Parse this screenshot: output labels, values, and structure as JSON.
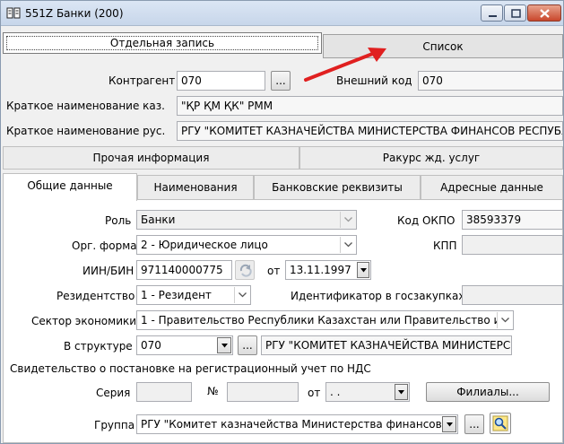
{
  "window": {
    "title": "551Z Банки (200)"
  },
  "top_tabs": {
    "record": "Отдельная запись",
    "list": "Список"
  },
  "header": {
    "counterparty_label": "Контрагент",
    "counterparty_value": "070",
    "external_code_label": "Внешний код",
    "external_code_value": "070",
    "short_name_kaz_label": "Краткое наименование каз.",
    "short_name_kaz_value": "\"ҚР ҚМ ҚК\" РММ",
    "short_name_rus_label": "Краткое наименование рус.",
    "short_name_rus_value": "РГУ \"КОМИТЕТ КАЗНАЧЕЙСТВА МИНИСТЕРСТВА ФИНАНСОВ РЕСПУБЛ",
    "ellipsis": "..."
  },
  "section_tabs": [
    "Прочая информация",
    "Ракурс жд. услуг"
  ],
  "sub_tabs": [
    "Общие данные",
    "Наименования",
    "Банковские реквизиты",
    "Адресные данные"
  ],
  "form": {
    "role_label": "Роль",
    "role_value": "Банки",
    "okpo_label": "Код ОКПО",
    "okpo_value": "38593379",
    "org_form_label": "Орг. форма",
    "org_form_value": "2 - Юридическое лицо",
    "kpp_label": "КПП",
    "kpp_value": "",
    "iin_label": "ИИН/БИН",
    "iin_value": "971140000775",
    "from_label": "от",
    "date_value": "13.11.1997",
    "residency_label": "Резидентство",
    "residency_value": "1 - Резидент",
    "procurement_id_label": "Идентификатор в госзакупках",
    "procurement_id_value": "",
    "sector_label": "Сектор экономики",
    "sector_value": "1 - Правительство Республики Казахстан или Правительство и",
    "structure_label": "В структуре",
    "structure_code": "070",
    "structure_name": "РГУ \"КОМИТЕТ КАЗНАЧЕЙСТВА МИНИСТЕРС",
    "vat_label": "Свидетельство о постановке на регистрационный учет по НДС",
    "series_label": "Серия",
    "series_value": "",
    "number_label": "№",
    "number_value": "",
    "vat_from_label": "от",
    "vat_date_value": " .  .",
    "branches_button": "Филиалы...",
    "group_label": "Группа",
    "group_value": "РГУ \"Комитет казначейства Министерства финансов I"
  },
  "colors": {
    "annotation_arrow": "#e02020",
    "titlebar": "#dbe6f4",
    "close_button": "#c9472c"
  }
}
